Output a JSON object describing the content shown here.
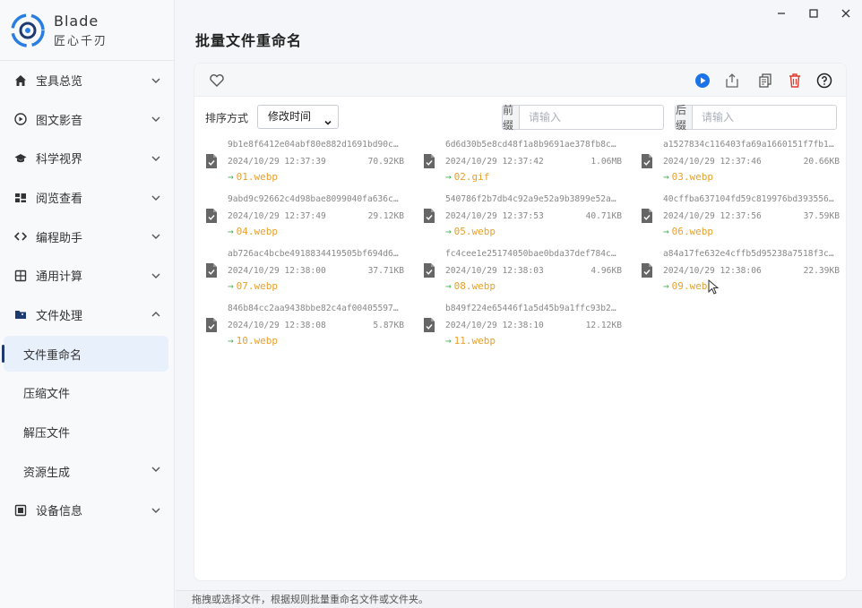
{
  "app": {
    "name": "Blade",
    "subtitle": "匠心千刃"
  },
  "sidebar": {
    "items": [
      {
        "label": "宝具总览",
        "icon": "home-icon",
        "expandable": true
      },
      {
        "label": "图文影音",
        "icon": "media-play-icon",
        "expandable": true
      },
      {
        "label": "科学视界",
        "icon": "graduation-cap-icon",
        "expandable": true
      },
      {
        "label": "阅览查看",
        "icon": "grid-view-icon",
        "expandable": true
      },
      {
        "label": "编程助手",
        "icon": "code-icon",
        "expandable": true
      },
      {
        "label": "通用计算",
        "icon": "calculator-icon",
        "expandable": true
      },
      {
        "label": "文件处理",
        "icon": "folder-icon",
        "expandable": true,
        "expanded": true
      }
    ],
    "sub_items": [
      {
        "label": "文件重命名",
        "active": true
      },
      {
        "label": "压缩文件"
      },
      {
        "label": "解压文件"
      },
      {
        "label": "资源生成",
        "expandable": true
      }
    ],
    "bottom_item": {
      "label": "设备信息",
      "icon": "chip-icon",
      "expandable": true
    }
  },
  "page": {
    "title": "批量文件重命名"
  },
  "toolbar": {
    "icons": [
      "heart-icon",
      "play-icon",
      "export-icon",
      "copy-icon",
      "trash-icon",
      "help-icon"
    ],
    "colors": {
      "play": "#1a73e8",
      "trash": "#e0392f"
    }
  },
  "sort": {
    "label": "排序方式",
    "selected": "修改时间"
  },
  "prefix": {
    "label": "前缀",
    "placeholder": "请输入"
  },
  "suffix": {
    "label": "后缀",
    "placeholder": "请输入"
  },
  "files": [
    {
      "name": "9b1e8f6412e04abf80e882d1691bd90c…",
      "date": "2024/10/29 12:37:39",
      "size": "70.92KB",
      "new_name": "01.webp"
    },
    {
      "name": "6d6d30b5e8cd48f1a8b9691ae378fb8c…",
      "date": "2024/10/29 12:37:42",
      "size": "1.06MB",
      "new_name": "02.gif"
    },
    {
      "name": "a1527834c116403fa69a1660151f7fb1…",
      "date": "2024/10/29 12:37:46",
      "size": "20.66KB",
      "new_name": "03.webp"
    },
    {
      "name": "9abd9c92662c4d98bae8099040fa636c…",
      "date": "2024/10/29 12:37:49",
      "size": "29.12KB",
      "new_name": "04.webp"
    },
    {
      "name": "540786f2b7db4c92a9e52a9b3899e52a…",
      "date": "2024/10/29 12:37:53",
      "size": "40.71KB",
      "new_name": "05.webp"
    },
    {
      "name": "40cffba637104fd59c819976bd393556…",
      "date": "2024/10/29 12:37:56",
      "size": "37.59KB",
      "new_name": "06.webp"
    },
    {
      "name": "ab726ac4bcbe4918834419505bf694d6…",
      "date": "2024/10/29 12:38:00",
      "size": "37.71KB",
      "new_name": "07.webp"
    },
    {
      "name": "fc4cee1e25174050bae0bda37def784c…",
      "date": "2024/10/29 12:38:03",
      "size": "4.96KB",
      "new_name": "08.webp"
    },
    {
      "name": "a84a17fe632e4cffb5d95238a7518f3c…",
      "date": "2024/10/29 12:38:06",
      "size": "22.39KB",
      "new_name": "09.webp"
    },
    {
      "name": "846b84cc2aa9438bbe82c4af00405597…",
      "date": "2024/10/29 12:38:08",
      "size": "5.87KB",
      "new_name": "10.webp"
    },
    {
      "name": "b849f224e65446f1a5d45b9a1ffc93b2…",
      "date": "2024/10/29 12:38:10",
      "size": "12.12KB",
      "new_name": "11.webp"
    }
  ],
  "status": {
    "text": "拖拽或选择文件，根据规则批量重命名文件或文件夹。"
  },
  "colors": {
    "accent_new_name": "#e8a02a",
    "arrow": "#46b35a",
    "active_bg": "#e8f0fb",
    "active_bar": "#1f3a6f"
  }
}
